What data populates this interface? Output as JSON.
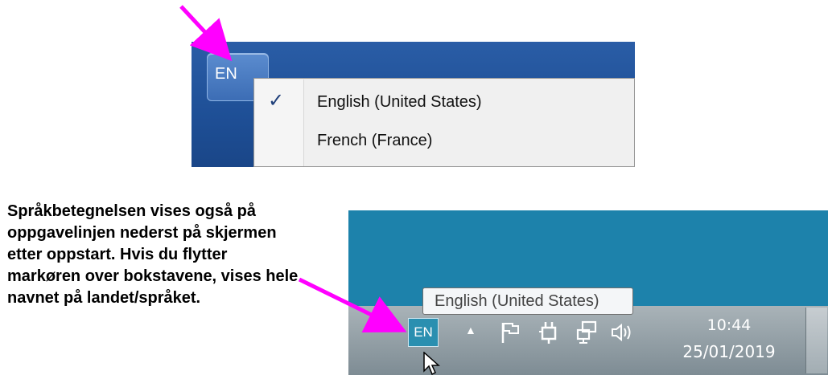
{
  "top_screenshot": {
    "language_button_label": "EN",
    "menu": {
      "items": [
        {
          "label": "English (United States)",
          "checked": true
        },
        {
          "label": "French (France)",
          "checked": false
        }
      ],
      "check_glyph": "✓"
    }
  },
  "caption": "Språkbetegnelsen vises også på oppgavelinjen nederst på skjermen etter oppstart. Hvis du flytter markøren over bokstavene, vises hele navnet på landet/språket.",
  "bottom_screenshot": {
    "tooltip": "English (United States)",
    "tray_language_label": "EN",
    "tray_icons": [
      "chevron-up-icon",
      "flag-icon",
      "power-icon",
      "network-icon",
      "speaker-icon"
    ],
    "clock_time": "10:44",
    "clock_date": "25/01/2019"
  },
  "colors": {
    "arrow": "#ff00ff",
    "desktop_top": "#1e4f96",
    "desktop_bottom": "#1d82ab"
  }
}
